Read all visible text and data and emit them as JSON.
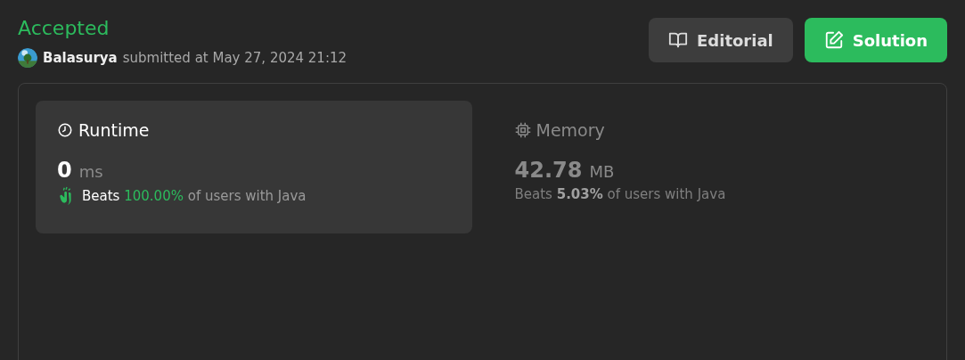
{
  "status": "Accepted",
  "submission": {
    "user": "Balasurya",
    "submitted": "submitted at May 27, 2024 21:12"
  },
  "buttons": [
    {
      "kind": "editorial",
      "label": "Editorial"
    },
    {
      "kind": "solution",
      "label": "Solution"
    }
  ],
  "stats": [
    {
      "kind": "runtime",
      "label": "Runtime",
      "selected": true,
      "value": "0",
      "unit": "ms",
      "beats_prefix": "Beats",
      "beats_value": "100.00%",
      "beats_suffix": "of users with Java"
    },
    {
      "kind": "memory",
      "label": "Memory",
      "selected": false,
      "value": "42.78",
      "unit": "MB",
      "beats_prefix": "Beats",
      "beats_value": "5.03%",
      "beats_suffix": "of users with Java"
    }
  ]
}
